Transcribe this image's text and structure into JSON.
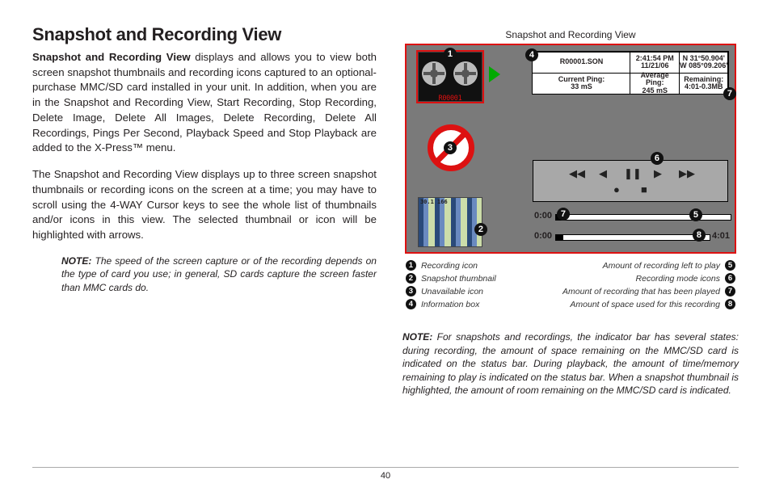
{
  "page_number": "40",
  "title": "Snapshot and Recording View",
  "paragraphs": {
    "p1_lead": "Snapshot and Recording View",
    "p1_rest": " displays and allows you to view both screen snapshot thumbnails and recording icons captured to an optional-purchase MMC/SD card installed in your unit. In addition, when you are in the Snapshot and Recording View, Start Recording, Stop Recording, Delete Image, Delete All Images, Delete Recording, Delete All Recordings, Pings Per Second, Playback Speed and Stop Playback are added to the X-Press™ menu.",
    "p2": "The Snapshot and Recording View displays up to three screen snapshot thumbnails or recording icons on the screen at a time; you may have to scroll using the 4-WAY Cursor keys to see the whole list of thumbnails and/or icons in this view. The selected thumbnail or icon will be highlighted with arrows."
  },
  "note1_label": "NOTE:",
  "note1": " The speed of the screen capture or of the recording depends on the type of card you use; in general, SD cards capture the screen faster than MMC cards do.",
  "fig_caption": "Snapshot and Recording View",
  "info_box": {
    "filename": "R00001.SON",
    "time": "2:41:54 PM",
    "date": "11/21/06",
    "lat": "N 31°50.904'",
    "lon": "W 085°09.206'",
    "current_ping_label": "Current Ping:",
    "current_ping_value": "33 mS",
    "average_ping_label": "Average Ping:",
    "average_ping_value": "245 mS",
    "remaining_label": "Remaining:",
    "remaining_value": "4:01-0.3MB"
  },
  "thumb_label": "R00001",
  "snap_overlay": "30.1\n166",
  "progress": {
    "top_left": "0:00",
    "bottom_left": "0:00",
    "bottom_right": "4:01"
  },
  "legend_left": {
    "1": "Recording icon",
    "2": "Snapshot thumbnail",
    "3": "Unavailable icon",
    "4": "Information box"
  },
  "legend_right": {
    "5": "Amount of recording left to play",
    "6": "Recording mode icons",
    "7": "Amount of recording that has been played",
    "8": "Amount of space used for this recording"
  },
  "note2_label": "NOTE:",
  "note2": " For snapshots and recordings, the indicator bar has several states: during recording, the amount of space remaining on the MMC/SD card is indicated on the status bar. During playback, the amount of time/memory remaining to play is indicated on the status bar. When a snapshot thumbnail is highlighted, the amount of room remaining on the MMC/SD card is indicated."
}
